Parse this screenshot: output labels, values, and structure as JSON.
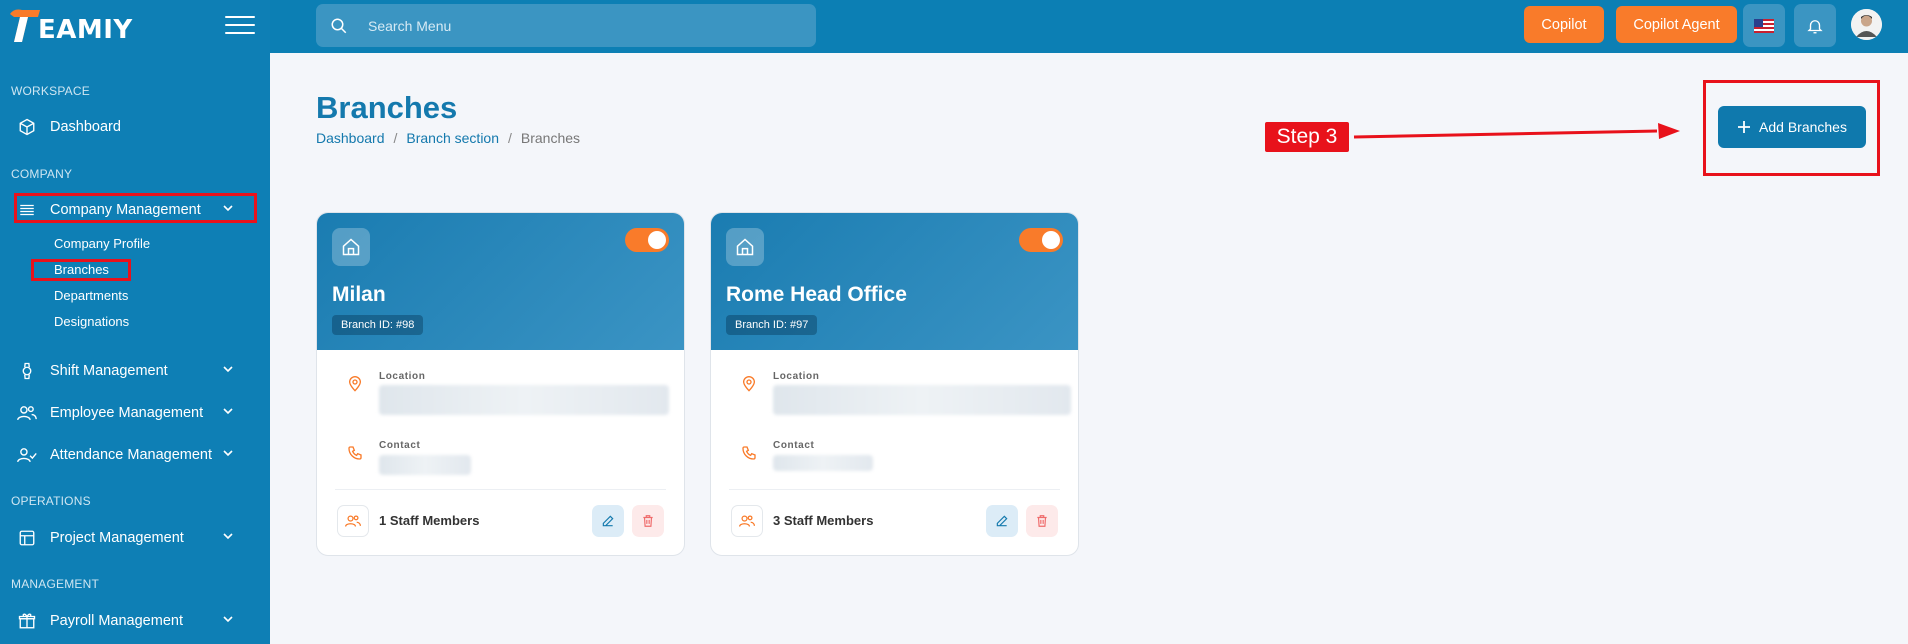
{
  "brand": {
    "logo_text": "EAMIY"
  },
  "search": {
    "placeholder": "Search Menu"
  },
  "topbar": {
    "copilot_label": "Copilot",
    "copilot_agent_label": "Copilot Agent",
    "language_icon": "us-flag-icon",
    "notification_icon": "bell-icon"
  },
  "sidebar": {
    "workspace_label": "WORKSPACE",
    "dashboard_label": "Dashboard",
    "company_label": "COMPANY",
    "company_management_label": "Company Management",
    "sub_items": [
      "Company Profile",
      "Branches",
      "Departments",
      "Designations"
    ],
    "shift_label": "Shift Management",
    "employee_label": "Employee Management",
    "attendance_label": "Attendance Management",
    "operations_label": "OPERATIONS",
    "project_label": "Project Management",
    "management_label": "MANAGEMENT",
    "payroll_label": "Payroll Management"
  },
  "page": {
    "title": "Branches",
    "breadcrumb": [
      "Dashboard",
      "Branch section",
      "Branches"
    ],
    "add_button_label": "Add Branches",
    "annotation_label": "Step 3"
  },
  "cards": [
    {
      "name": "Milan",
      "branch_id": "Branch ID: #98",
      "location_label": "Location",
      "contact_label": "Contact",
      "staff_text": "1 Staff Members",
      "active": true
    },
    {
      "name": "Rome Head Office",
      "branch_id": "Branch ID: #97",
      "location_label": "Location",
      "contact_label": "Contact",
      "staff_text": "3 Staff Members",
      "active": true
    }
  ],
  "colors": {
    "sidebar": "#0e7fb5",
    "accent_orange": "#f97b2a",
    "primary_blue": "#0f79ad",
    "annotation_red": "#e8121b"
  }
}
